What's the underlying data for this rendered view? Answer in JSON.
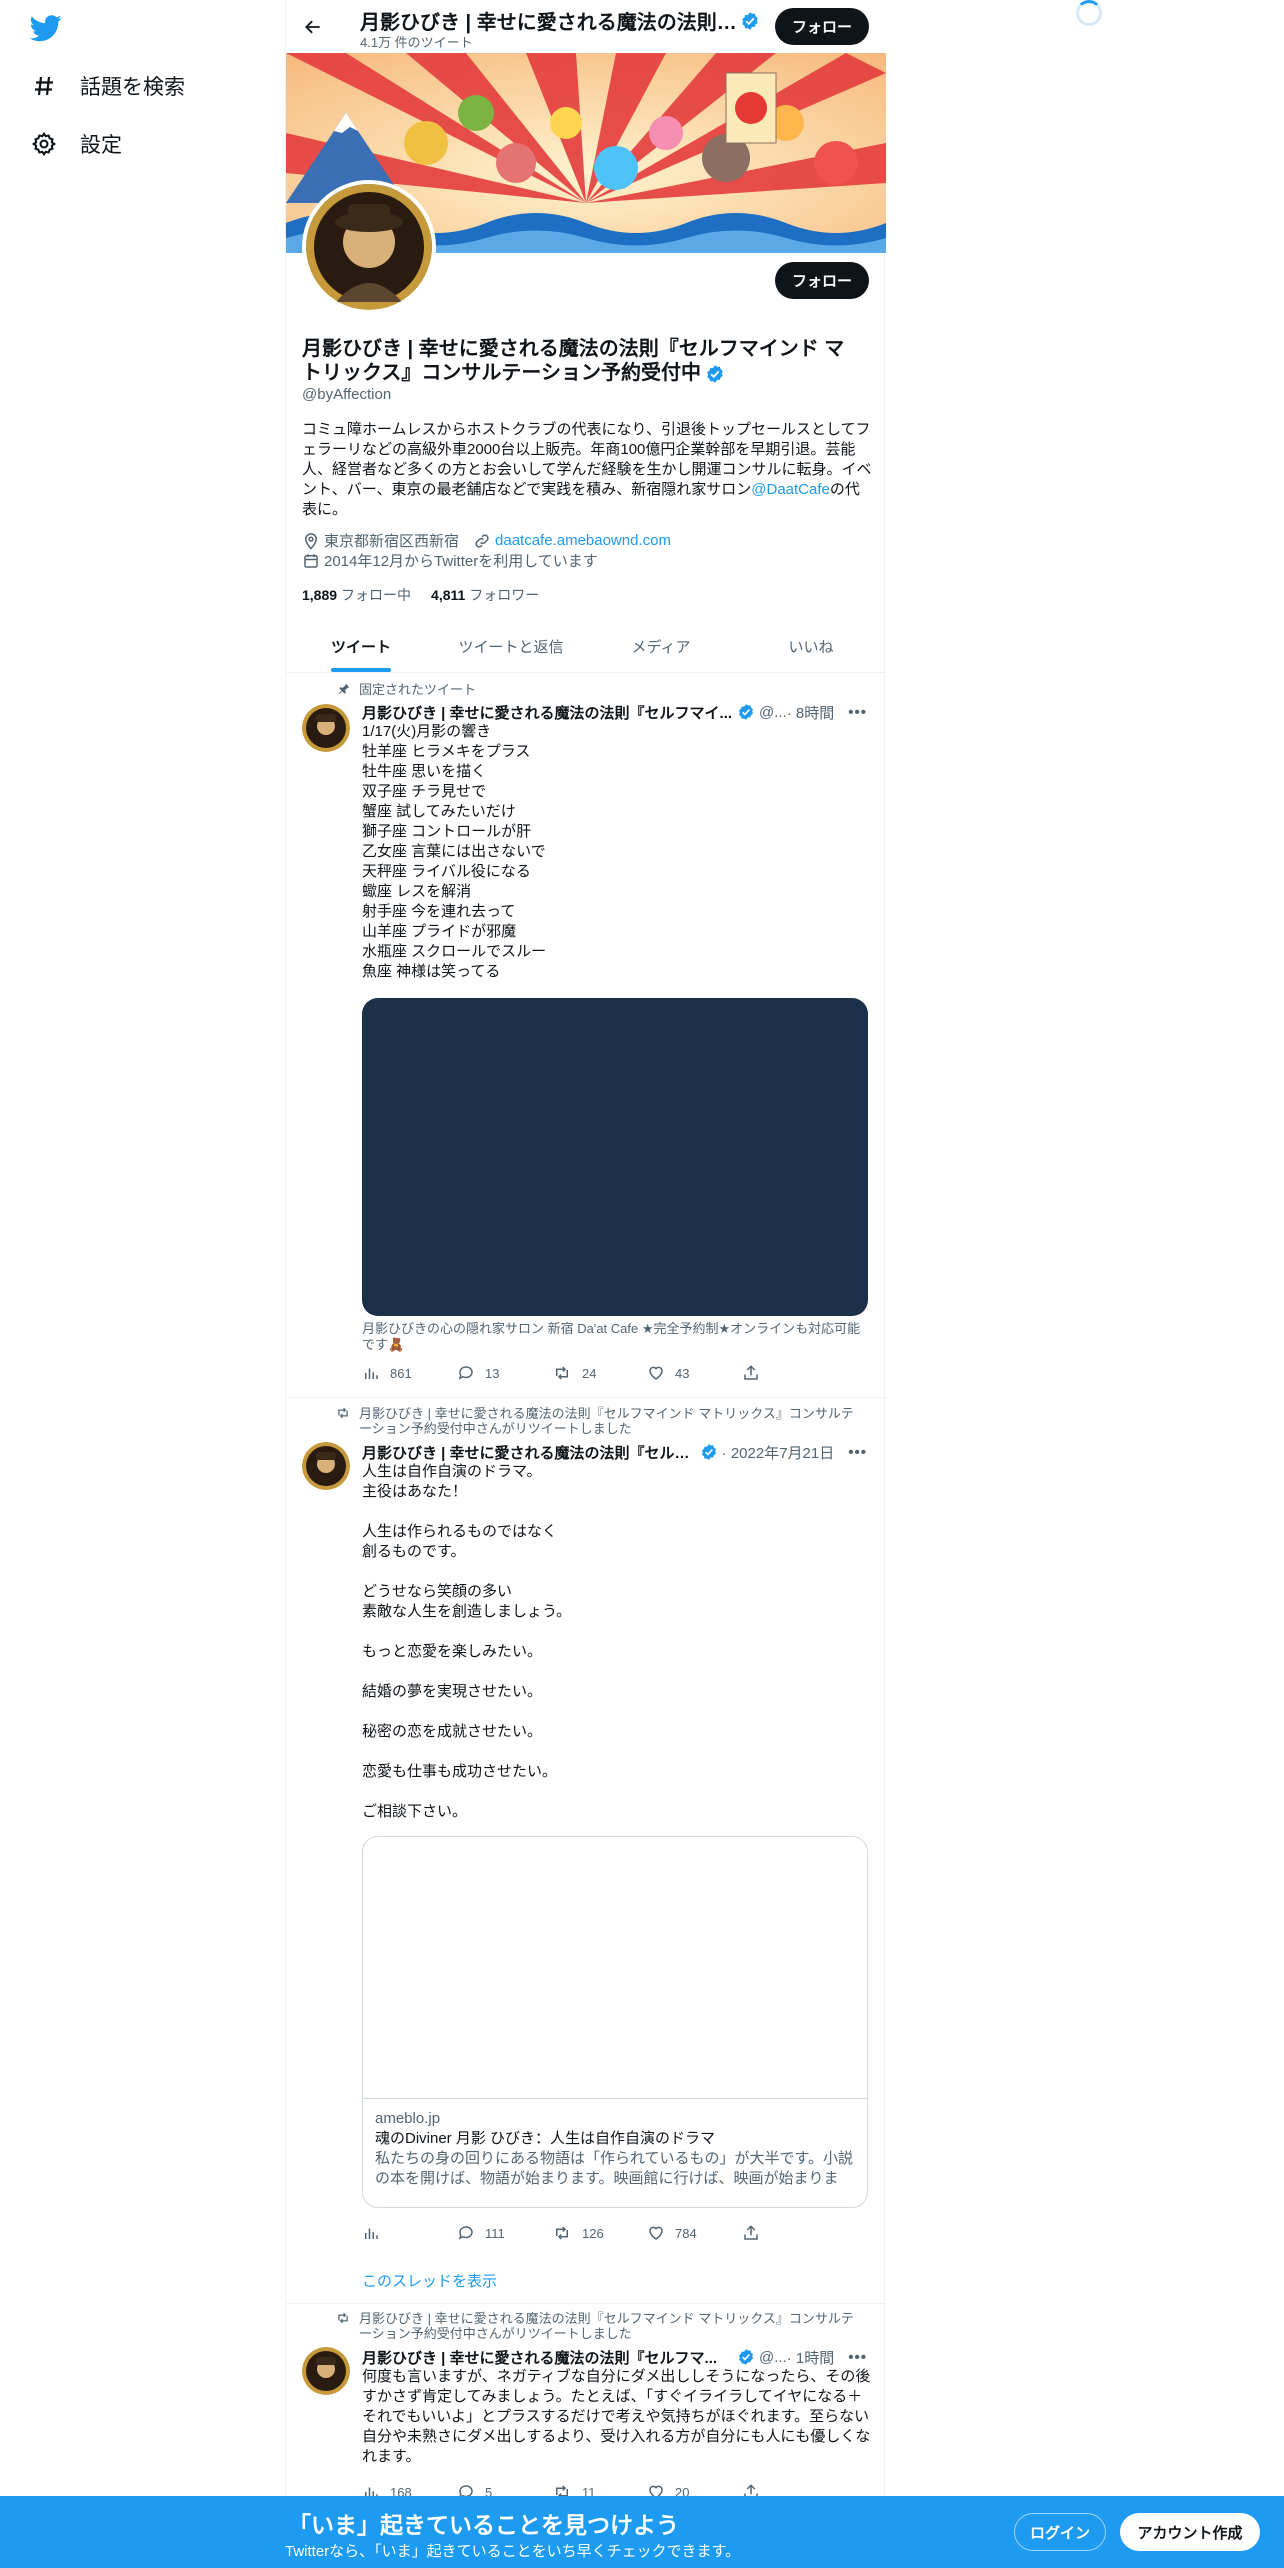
{
  "colors": {
    "accent": "#1d9bf0",
    "text": "#0f1419",
    "muted": "#536471",
    "media_bg": "#1c3049"
  },
  "nav": {
    "logo_icon": "twitter-bird-icon",
    "items": [
      {
        "label": "話題を検索",
        "icon": "hashtag-icon"
      },
      {
        "label": "設定",
        "icon": "gear-icon"
      }
    ]
  },
  "header": {
    "title": "月影ひびき | 幸せに愛される魔法の法則『…",
    "subtitle": "4.1万 件のツイート",
    "follow_label": "フォロー"
  },
  "profile": {
    "follow_label": "フォロー",
    "name": "月影ひびき | 幸せに愛される魔法の法則『セルフマインド マトリックス』コンサルテーション予約受付中",
    "handle": "@byAffection",
    "bio_text": "コミュ障ホームレスからホストクラブの代表になり、引退後トップセールスとしてフェラーリなどの高級外車2000台以上販売。年商100億円企業幹部を早期引退。芸能人、経営者など多くの方とお会いして学んだ経験を生かし開運コンサルに転身。イベント、バー、東京の最老舗店などで実践を積み、新宿隠れ家サロン",
    "bio_mention": "@DaatCafe",
    "bio_suffix": "の代表に。",
    "location": "東京都新宿区西新宿",
    "website": "daatcafe.amebaownd.com",
    "joined": "2014年12月からTwitterを利用しています",
    "following_count": "1,889",
    "following_label": "フォロー中",
    "followers_count": "4,811",
    "followers_label": "フォロワー"
  },
  "tabs": [
    {
      "label": "ツイート",
      "active": true
    },
    {
      "label": "ツイートと返信",
      "active": false
    },
    {
      "label": "メディア",
      "active": false
    },
    {
      "label": "いいね",
      "active": false
    }
  ],
  "tweets": [
    {
      "social_context": "固定されたツイート",
      "name": "月影ひびき | 幸せに愛される魔法の法則『セルフマイ...",
      "handle": "@...",
      "time": "· 8時間",
      "text": "1/17(火)月影の響き\n牡羊座 ヒラメキをプラス\n牡牛座 思いを描く\n双子座 チラ見せで\n蟹座 試してみたいだけ\n獅子座 コントロールが肝\n乙女座 言葉には出さないで\n天秤座 ライバル役になる\n蠍座 レスを解消\n射手座 今を連れ去って\n山羊座 プライドが邪魔\n水瓶座 スクロールでスルー\n魚座 神様は笑ってる",
      "media_caption": "月影ひびきの心の隠れ家サロン 新宿 Da'at Cafe ★完全予約制★オンラインも対応可能です🧸",
      "views": "861",
      "replies": "13",
      "retweets": "24",
      "likes": "43"
    },
    {
      "social_context": "月影ひびき | 幸せに愛される魔法の法則『セルフマインド マトリックス』コンサルテーション予約受付中さんがリツイートしました",
      "name": "月影ひびき | 幸せに愛される魔法の法則『セルフ...",
      "handle": "",
      "time": "· 2022年7月21日",
      "text": "人生は自作自演のドラマ。\n主役はあなた！\n\n人生は作られるものではなく\n創るものです。\n\nどうせなら笑顔の多い\n素敵な人生を創造しましょう。\n\nもっと恋愛を楽しみたい。\n\n結婚の夢を実現させたい。\n\n秘密の恋を成就させたい。\n\n恋愛も仕事も成功させたい。\n\nご相談下さい。",
      "card_domain": "ameblo.jp",
      "card_title": "魂のDiviner 月影 ひびき：人生は自作自演のドラマ",
      "card_desc": "私たちの身の回りにある物語は「作られているもの」が大半です。小説の本を開けば、物語が始まります。映画館に行けば、映画が始まります。",
      "views": "",
      "replies": "111",
      "retweets": "126",
      "likes": "784",
      "thread_link": "このスレッドを表示"
    },
    {
      "social_context": "月影ひびき | 幸せに愛される魔法の法則『セルフマインド マトリックス』コンサルテーション予約受付中さんがリツイートしました",
      "name": "月影ひびき | 幸せに愛される魔法の法則『セルフマ...",
      "handle": "@...",
      "time": "· 1時間",
      "text": "何度も言いますが、ネガティブな自分にダメ出ししそうになったら、その後すかさず肯定してみましょう。たとえば、「すぐイライラしてイヤになる＋それでもいいよ」とプラスするだけで考えや気持ちがほぐれます。至らない自分や未熟さにダメ出しするより、受け入れる方が自分にも人にも優しくなれます。",
      "views": "168",
      "replies": "5",
      "retweets": "11",
      "likes": "20"
    }
  ],
  "bottom_bar": {
    "title": "「いま」起きていることを見つけよう",
    "subtitle": "Twitterなら、「いま」起きていることをいち早くチェックできます。",
    "login_label": "ログイン",
    "signup_label": "アカウント作成"
  }
}
